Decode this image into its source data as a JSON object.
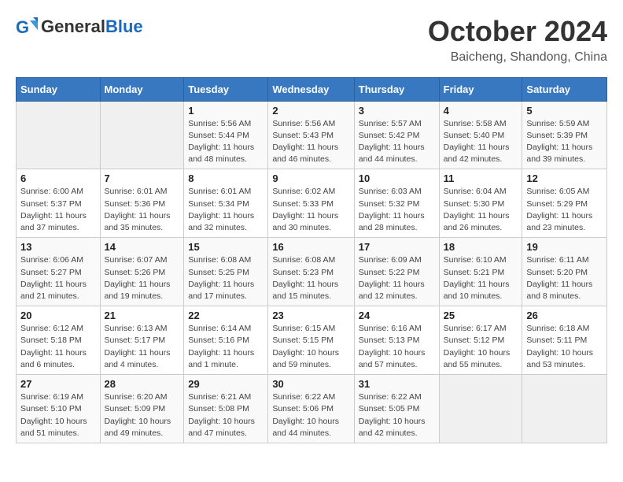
{
  "logo": {
    "general": "General",
    "blue": "Blue"
  },
  "header": {
    "month": "October 2024",
    "location": "Baicheng, Shandong, China"
  },
  "weekdays": [
    "Sunday",
    "Monday",
    "Tuesday",
    "Wednesday",
    "Thursday",
    "Friday",
    "Saturday"
  ],
  "weeks": [
    [
      {
        "day": "",
        "info": ""
      },
      {
        "day": "",
        "info": ""
      },
      {
        "day": "1",
        "info": "Sunrise: 5:56 AM\nSunset: 5:44 PM\nDaylight: 11 hours and 48 minutes."
      },
      {
        "day": "2",
        "info": "Sunrise: 5:56 AM\nSunset: 5:43 PM\nDaylight: 11 hours and 46 minutes."
      },
      {
        "day": "3",
        "info": "Sunrise: 5:57 AM\nSunset: 5:42 PM\nDaylight: 11 hours and 44 minutes."
      },
      {
        "day": "4",
        "info": "Sunrise: 5:58 AM\nSunset: 5:40 PM\nDaylight: 11 hours and 42 minutes."
      },
      {
        "day": "5",
        "info": "Sunrise: 5:59 AM\nSunset: 5:39 PM\nDaylight: 11 hours and 39 minutes."
      }
    ],
    [
      {
        "day": "6",
        "info": "Sunrise: 6:00 AM\nSunset: 5:37 PM\nDaylight: 11 hours and 37 minutes."
      },
      {
        "day": "7",
        "info": "Sunrise: 6:01 AM\nSunset: 5:36 PM\nDaylight: 11 hours and 35 minutes."
      },
      {
        "day": "8",
        "info": "Sunrise: 6:01 AM\nSunset: 5:34 PM\nDaylight: 11 hours and 32 minutes."
      },
      {
        "day": "9",
        "info": "Sunrise: 6:02 AM\nSunset: 5:33 PM\nDaylight: 11 hours and 30 minutes."
      },
      {
        "day": "10",
        "info": "Sunrise: 6:03 AM\nSunset: 5:32 PM\nDaylight: 11 hours and 28 minutes."
      },
      {
        "day": "11",
        "info": "Sunrise: 6:04 AM\nSunset: 5:30 PM\nDaylight: 11 hours and 26 minutes."
      },
      {
        "day": "12",
        "info": "Sunrise: 6:05 AM\nSunset: 5:29 PM\nDaylight: 11 hours and 23 minutes."
      }
    ],
    [
      {
        "day": "13",
        "info": "Sunrise: 6:06 AM\nSunset: 5:27 PM\nDaylight: 11 hours and 21 minutes."
      },
      {
        "day": "14",
        "info": "Sunrise: 6:07 AM\nSunset: 5:26 PM\nDaylight: 11 hours and 19 minutes."
      },
      {
        "day": "15",
        "info": "Sunrise: 6:08 AM\nSunset: 5:25 PM\nDaylight: 11 hours and 17 minutes."
      },
      {
        "day": "16",
        "info": "Sunrise: 6:08 AM\nSunset: 5:23 PM\nDaylight: 11 hours and 15 minutes."
      },
      {
        "day": "17",
        "info": "Sunrise: 6:09 AM\nSunset: 5:22 PM\nDaylight: 11 hours and 12 minutes."
      },
      {
        "day": "18",
        "info": "Sunrise: 6:10 AM\nSunset: 5:21 PM\nDaylight: 11 hours and 10 minutes."
      },
      {
        "day": "19",
        "info": "Sunrise: 6:11 AM\nSunset: 5:20 PM\nDaylight: 11 hours and 8 minutes."
      }
    ],
    [
      {
        "day": "20",
        "info": "Sunrise: 6:12 AM\nSunset: 5:18 PM\nDaylight: 11 hours and 6 minutes."
      },
      {
        "day": "21",
        "info": "Sunrise: 6:13 AM\nSunset: 5:17 PM\nDaylight: 11 hours and 4 minutes."
      },
      {
        "day": "22",
        "info": "Sunrise: 6:14 AM\nSunset: 5:16 PM\nDaylight: 11 hours and 1 minute."
      },
      {
        "day": "23",
        "info": "Sunrise: 6:15 AM\nSunset: 5:15 PM\nDaylight: 10 hours and 59 minutes."
      },
      {
        "day": "24",
        "info": "Sunrise: 6:16 AM\nSunset: 5:13 PM\nDaylight: 10 hours and 57 minutes."
      },
      {
        "day": "25",
        "info": "Sunrise: 6:17 AM\nSunset: 5:12 PM\nDaylight: 10 hours and 55 minutes."
      },
      {
        "day": "26",
        "info": "Sunrise: 6:18 AM\nSunset: 5:11 PM\nDaylight: 10 hours and 53 minutes."
      }
    ],
    [
      {
        "day": "27",
        "info": "Sunrise: 6:19 AM\nSunset: 5:10 PM\nDaylight: 10 hours and 51 minutes."
      },
      {
        "day": "28",
        "info": "Sunrise: 6:20 AM\nSunset: 5:09 PM\nDaylight: 10 hours and 49 minutes."
      },
      {
        "day": "29",
        "info": "Sunrise: 6:21 AM\nSunset: 5:08 PM\nDaylight: 10 hours and 47 minutes."
      },
      {
        "day": "30",
        "info": "Sunrise: 6:22 AM\nSunset: 5:06 PM\nDaylight: 10 hours and 44 minutes."
      },
      {
        "day": "31",
        "info": "Sunrise: 6:22 AM\nSunset: 5:05 PM\nDaylight: 10 hours and 42 minutes."
      },
      {
        "day": "",
        "info": ""
      },
      {
        "day": "",
        "info": ""
      }
    ]
  ]
}
